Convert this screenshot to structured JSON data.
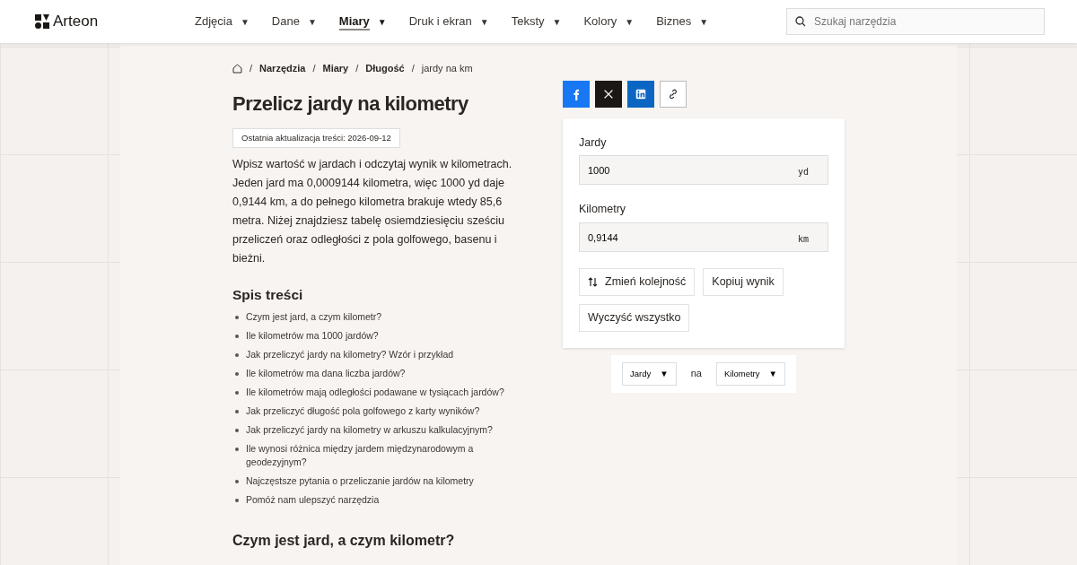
{
  "logo": {
    "text": "Arteon"
  },
  "nav": [
    {
      "label": "Zdjęcia",
      "selected": false
    },
    {
      "label": "Dane",
      "selected": false
    },
    {
      "label": "Miary",
      "selected": true
    },
    {
      "label": "Druk i ekran",
      "selected": false
    },
    {
      "label": "Teksty",
      "selected": false
    },
    {
      "label": "Kolory",
      "selected": false
    },
    {
      "label": "Biznes",
      "selected": false
    }
  ],
  "nav_caret": "▼",
  "search": {
    "placeholder": "Szukaj narzędzia"
  },
  "breadcrumb": [
    "Narzędzia",
    "Miary",
    "Długość",
    "jardy na km"
  ],
  "breadcrumb_separator": "/",
  "title": "Przelicz jardy na kilometry",
  "updated": "Ostatnia aktualizacja treści: 2026-09-12",
  "intro": "Wpisz wartość w jardach i odczytaj wynik w kilometrach. Jeden jard ma 0,0009144 kilometra, więc 1000 yd daje 0,9144 km, a do pełnego kilometra brakuje wtedy 85,6 metra. Niżej znajdziesz tabelę osiemdziesięciu sześciu przeliczeń oraz odległości z pola golfowego, basenu i bieżni.",
  "toc": {
    "title": "Spis treści",
    "items": [
      "Czym jest jard, a czym kilometr?",
      "Ile kilometrów ma 1000 jardów?",
      "Jak przeliczyć jardy na kilometry? Wzór i przykład",
      "Ile kilometrów ma dana liczba jardów?",
      "Ile kilometrów mają odległości podawane w tysiącach jardów?",
      "Jak przeliczyć długość pola golfowego z karty wyników?",
      "Jak przeliczyć jardy na kilometry w arkuszu kalkulacyjnym?",
      "Ile wynosi różnica między jardem międzynarodowym a geodezyjnym?",
      "Najczęstsze pytania o przeliczanie jardów na kilometry",
      "Pomóż nam ulepszyć narzędzia"
    ]
  },
  "next_heading": "Czym jest jard, a czym kilometr?",
  "share": [
    {
      "kind": "facebook"
    },
    {
      "kind": "x"
    },
    {
      "kind": "linkedin"
    },
    {
      "kind": "link"
    }
  ],
  "converter": {
    "fields": [
      {
        "label": "Jardy",
        "value": "1000",
        "unit": "yd"
      },
      {
        "label": "Kilometry",
        "value": "0,9144",
        "unit": "km"
      }
    ],
    "buttons": [
      {
        "label": "Zmień kolejność",
        "kind": "swap"
      },
      {
        "label": "Kopiuj wynik",
        "kind": "plain"
      },
      {
        "label": "Wyczyść wszystko",
        "kind": "plain"
      }
    ]
  },
  "unit_picker": {
    "from": "Jardy",
    "joiner": "na",
    "to": "Kilometry",
    "caret": "▼"
  }
}
